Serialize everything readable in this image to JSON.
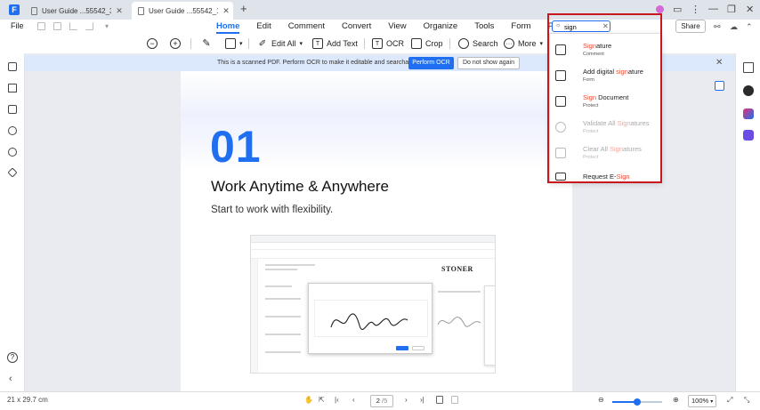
{
  "tabs": [
    {
      "label": "User Guide ...55542_3.pdf",
      "active": false
    },
    {
      "label": "User Guide ...55542_1.pdf",
      "active": true
    }
  ],
  "tab_close": "✕",
  "tab_add": "+",
  "file_menu": "File",
  "menu": [
    {
      "label": "Home",
      "active": true
    },
    {
      "label": "Edit"
    },
    {
      "label": "Comment"
    },
    {
      "label": "Convert"
    },
    {
      "label": "View"
    },
    {
      "label": "Organize"
    },
    {
      "label": "Tools"
    },
    {
      "label": "Form"
    },
    {
      "label": "Protect"
    }
  ],
  "share_label": "Share",
  "toolbar": {
    "edit_all": "Edit All",
    "add_text": "Add Text",
    "ocr": "OCR",
    "crop": "Crop",
    "search": "Search",
    "more": "More"
  },
  "ocr_banner": {
    "text": "This is a scanned PDF. Perform OCR to make it editable and searchable.",
    "perform_label": "Perform OCR",
    "dismiss_label": "Do not show again"
  },
  "document": {
    "number": "01",
    "heading": "Work Anytime & Anywhere",
    "subheading": "Start to work with flexibility.",
    "embedded_brand": "STONER"
  },
  "search": {
    "value": "sign",
    "query_highlight": "sign",
    "results": [
      {
        "before": "",
        "match": "Sign",
        "after": "ature",
        "category": "Comment",
        "enabled": true
      },
      {
        "before": "Add digital ",
        "match": "sign",
        "after": "ature",
        "category": "Form",
        "enabled": true
      },
      {
        "before": "",
        "match": "Sign",
        "after": " Document",
        "category": "Protect",
        "enabled": true
      },
      {
        "before": "Validate All ",
        "match": "Sign",
        "after": "atures",
        "category": "Protect",
        "enabled": false
      },
      {
        "before": "Clear All ",
        "match": "Sign",
        "after": "atures",
        "category": "Protect",
        "enabled": false
      },
      {
        "before": "Request E-",
        "match": "Sign",
        "after": "",
        "category": "",
        "enabled": true
      }
    ]
  },
  "status": {
    "page_size": "21 x 29.7 cm",
    "page_current": "2",
    "page_total": "/5",
    "zoom": "100%",
    "zoom_fraction": 0.5
  },
  "colors": {
    "accent": "#1f6ff0",
    "highlight": "#e94b35",
    "annotation_frame": "#c9171e"
  }
}
